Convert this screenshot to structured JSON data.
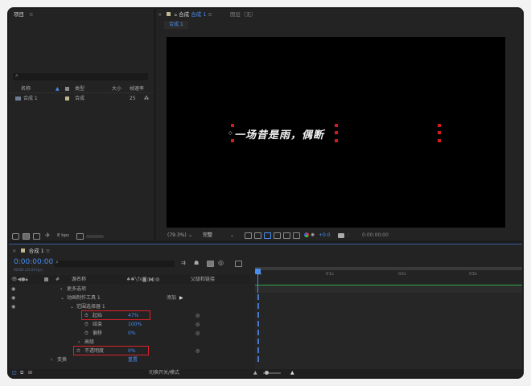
{
  "project_panel": {
    "title": "项目",
    "columns": {
      "name": "名称",
      "type": "类型",
      "size": "大小",
      "fps": "帧速率"
    },
    "items": [
      {
        "name": "合成 1",
        "type": "合成",
        "fps": "25"
      }
    ],
    "bottom": {
      "bpc": "8 bpc"
    }
  },
  "comp_panel": {
    "tab_label": "合成",
    "tab_comp": "合成 1",
    "layer_label": "图层（无）",
    "sub_tab": "合成 1",
    "canvas_text": "一场昔是雨，偶断",
    "zoom": "(79.3%)",
    "quality": "完整",
    "exposure": "+0.0",
    "timecode": "0:00:00:00"
  },
  "timeline": {
    "tab_label": "合成 1",
    "timecode": "0:00:00:00",
    "timecode_sub": "00000 (25.00 fps)",
    "header": {
      "source": "源名称",
      "parent": "父级和链接"
    },
    "ruler": [
      "0s",
      "01s",
      "02s",
      "03s"
    ],
    "rows": [
      {
        "label": "文本",
        "indent": 1
      },
      {
        "label": "更多选项",
        "indent": 2
      },
      {
        "label": "动画制作工具 1",
        "indent": 2,
        "extra": "添加"
      },
      {
        "label": "范围选择器 1",
        "indent": 3
      },
      {
        "label": "起始",
        "indent": 4,
        "value": "47%"
      },
      {
        "label": "结束",
        "indent": 4,
        "value": "100%"
      },
      {
        "label": "偏移",
        "indent": 4,
        "value": "0%"
      },
      {
        "label": "高级",
        "indent": 3
      },
      {
        "label": "不透明度",
        "indent": 3,
        "value": "0%"
      },
      {
        "label": "变换",
        "indent": 1,
        "value": "重置"
      }
    ],
    "footer": "切换开关/模式"
  }
}
